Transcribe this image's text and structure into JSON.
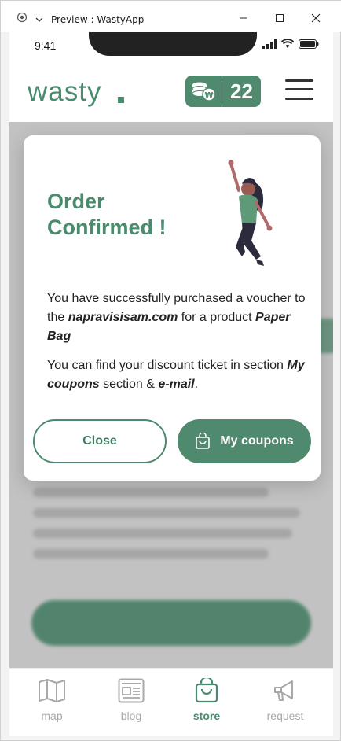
{
  "window": {
    "title": "Preview : WastyApp"
  },
  "status_bar": {
    "time": "9:41"
  },
  "header": {
    "logo": "wasty",
    "coins": "22"
  },
  "modal": {
    "title_line1": "Order",
    "title_line2": "Confirmed !",
    "p1_a": "You have successfully purchased a voucher to the ",
    "p1_site": "napravisisam.com",
    "p1_b": " for a product ",
    "p1_product": "Paper Bag",
    "p2_a": "You can find your discount ticket in section ",
    "p2_section": "My coupons",
    "p2_b": " section & ",
    "p2_email": "e-mail",
    "p2_c": ".",
    "close_label": "Close",
    "coupons_label": "My coupons"
  },
  "nav": {
    "items": [
      {
        "label": "map",
        "icon": "map-icon"
      },
      {
        "label": "blog",
        "icon": "blog-icon"
      },
      {
        "label": "store",
        "icon": "shopping-bag-icon",
        "active": true
      },
      {
        "label": "request",
        "icon": "megaphone-icon"
      }
    ]
  },
  "colors": {
    "accent": "#4a8a6d",
    "accent_dark": "#3f7a5f",
    "inactive": "#a8a8a8"
  }
}
